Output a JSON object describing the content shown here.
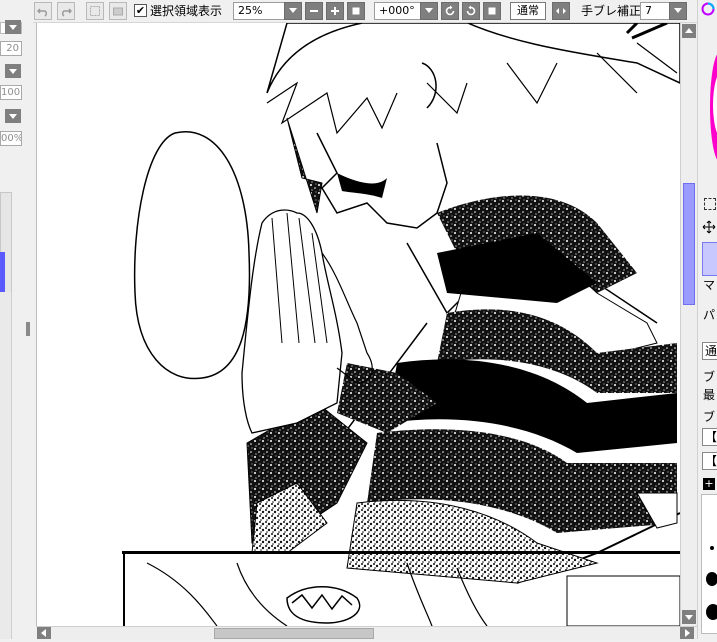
{
  "toolbar": {
    "selection_checkbox_checked": true,
    "selection_label": "選択領域表示",
    "zoom": "25%",
    "rotation": "+000°",
    "blend_mode": "通常",
    "stabilizer_label": "手ブレ補正",
    "stabilizer_value": "7",
    "icons": [
      "undo-icon",
      "redo-icon",
      "deselect-icon",
      "select-invert-icon",
      "zoom-out-icon",
      "zoom-in-icon",
      "zoom-reset-icon",
      "rotate-left-icon",
      "rotate-right-icon",
      "rotate-reset-icon",
      "flip-icon"
    ]
  },
  "left_panel": {
    "fields": [
      "20",
      "100",
      "00%"
    ]
  },
  "right_panel": {
    "labels": [
      "マ",
      "パ",
      "通",
      "ブ",
      "最",
      "ブ",
      "【",
      "【"
    ],
    "color_wheel_colors": [
      "#ff00ff",
      "#00a0ff",
      "#ffff00"
    ],
    "accent": "#5a5aff"
  }
}
